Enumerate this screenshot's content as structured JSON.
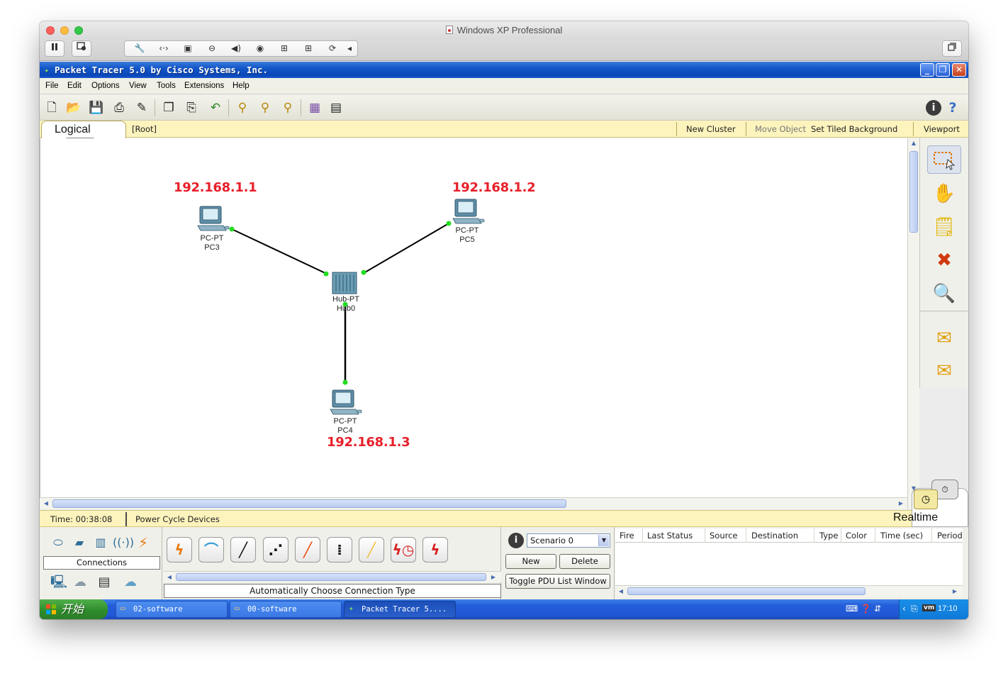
{
  "mac_window": {
    "title": "Windows XP Professional"
  },
  "vm_toolbar": {
    "pause_icon": "pause-icon",
    "devices": [
      "wrench-icon",
      "network-icon",
      "disk-icon",
      "lock-icon",
      "sound-icon",
      "camera-icon",
      "usb-icon",
      "usb-icon",
      "sync-icon",
      "chevron-left-icon"
    ]
  },
  "app": {
    "title": "Packet Tracer 5.0 by Cisco Systems, Inc."
  },
  "menu": {
    "items": [
      "File",
      "Edit",
      "Options",
      "View",
      "Tools",
      "Extensions",
      "Help"
    ]
  },
  "logical_bar": {
    "tab_label": "Logical",
    "root": "[Root]",
    "new_cluster": "New Cluster",
    "move_object": "Move Object",
    "set_tiled_background": "Set Tiled Background",
    "viewport": "Viewport"
  },
  "topology": {
    "ip_labels": {
      "pc3": "192.168.1.1",
      "pc5": "192.168.1.2",
      "pc4": "192.168.1.3"
    },
    "devices": {
      "pc3": {
        "model": "PC-PT",
        "name": "PC3"
      },
      "pc5": {
        "model": "PC-PT",
        "name": "PC5"
      },
      "hub0": {
        "model": "Hub-PT",
        "name": "Hub0"
      },
      "pc4": {
        "model": "PC-PT",
        "name": "PC4"
      }
    },
    "link_color": "#000000",
    "port_color": "#22dd22"
  },
  "status_bar": {
    "time": "Time: 00:38:08",
    "power_cycle": "Power Cycle Devices",
    "mode": "Realtime"
  },
  "bottom": {
    "connections_label": "Connections",
    "connection_description": "Automatically Choose Connection Type",
    "scenario": {
      "selected": "Scenario 0",
      "new": "New",
      "delete": "Delete",
      "toggle": "Toggle PDU List Window"
    },
    "pdu_columns": [
      "Fire",
      "Last Status",
      "Source",
      "Destination",
      "Type",
      "Color",
      "Time (sec)",
      "Period"
    ]
  },
  "taskbar": {
    "start": "开始",
    "tasks": [
      "02-software",
      "00-software",
      "Packet Tracer 5...."
    ],
    "clock": "17:10"
  },
  "colors": {
    "ip_label": "#e8202a",
    "xp_title": "#0a47b8",
    "yellow_bar": "#fcf3bd"
  }
}
